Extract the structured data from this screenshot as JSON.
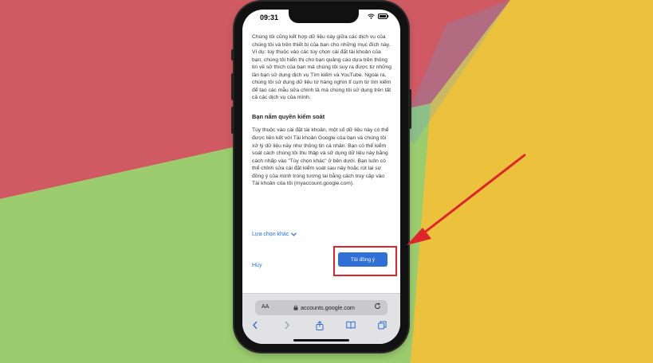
{
  "status": {
    "time": "09:31"
  },
  "content": {
    "para1": "Chúng tôi cũng kết hợp dữ liệu này giữa các dịch vụ của chúng tôi và trên thiết bị của bạn cho những mục đích này. Ví dụ: tùy thuộc vào các tùy chọn cài đặt tài khoản của bạn, chúng tôi hiển thị cho bạn quảng cáo dựa trên thông tin về sở thích của bạn mà chúng tôi suy ra được từ những lần bạn sử dụng dịch vụ Tìm kiếm và YouTube. Ngoài ra, chúng tôi sử dụng dữ liệu từ hàng nghìn tỉ cụm từ tìm kiếm để tạo các mẫu sửa chính tả mà chúng tôi sử dụng trên tất cả các dịch vụ của mình.",
    "section_title": "Bạn nắm quyền kiểm soát",
    "para2": "Tùy thuộc vào cài đặt tài khoản, một số dữ liệu này có thể được liên kết với Tài khoản Google của bạn và chúng tôi xử lý dữ liệu này như thông tin cá nhân. Bạn có thể kiểm soát cách chúng tôi thu thập và sử dụng dữ liệu này bằng cách nhấp vào \"Tùy chọn khác\" ở bên dưới. Bạn luôn có thể chỉnh sửa cài đặt kiểm soát sau này hoặc rút lại sự đồng ý của mình trong tương lai bằng cách truy cập vào Tài khoản của tôi (myaccount.google.com)."
  },
  "actions": {
    "more_options": "Lựa chọn khác",
    "cancel": "Hủy",
    "agree": "Tôi đồng ý"
  },
  "browser": {
    "text_size": "AA",
    "url": "accounts.google.com"
  },
  "icons": {
    "more_chevron": "chevron-down-icon",
    "lock": "lock-icon",
    "reload": "reload-icon",
    "back": "chevron-left-icon",
    "forward": "chevron-right-icon",
    "share": "share-icon",
    "bookmarks": "book-icon",
    "tabs": "tabs-icon"
  },
  "colors": {
    "accent": "#1a73e8",
    "button": "#2f6fd6",
    "highlight": "#e0242b",
    "bg_red": "#cf5a63",
    "bg_green": "#9bcd6f",
    "bg_yellow": "#ecc23c"
  }
}
